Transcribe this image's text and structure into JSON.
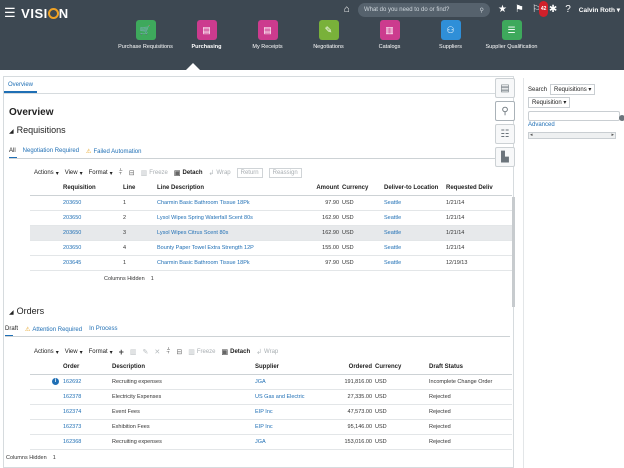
{
  "header": {
    "brand": "VISI",
    "brand_suffix": "N",
    "search_placeholder": "What do you need to do or find?",
    "notification_count": "42",
    "user_name": "Calvin Roth",
    "tiles": [
      {
        "label": "Purchase Requisitions",
        "color": "#3ea95c",
        "icon": "cart-icon"
      },
      {
        "label": "Purchasing",
        "color": "#cc3b8e",
        "icon": "document-icon"
      },
      {
        "label": "My Receipts",
        "color": "#cc3b8e",
        "icon": "receipt-icon"
      },
      {
        "label": "Negotiations",
        "color": "#79b13a",
        "icon": "negotiation-icon"
      },
      {
        "label": "Catalogs",
        "color": "#cc3b8e",
        "icon": "catalog-icon"
      },
      {
        "label": "Suppliers",
        "color": "#2f8fd8",
        "icon": "suppliers-icon"
      },
      {
        "label": "Supplier Qualification",
        "color": "#3ea95c",
        "icon": "checklist-icon"
      }
    ]
  },
  "page": {
    "tab": "Overview",
    "title": "Overview"
  },
  "requisitions": {
    "title": "Requisitions",
    "subtabs": [
      "All",
      "Negotiation Required",
      "Failed Automation"
    ],
    "toolbar": {
      "actions": "Actions",
      "view": "View",
      "format": "Format",
      "freeze": "Freeze",
      "detach": "Detach",
      "wrap": "Wrap",
      "return": "Return",
      "reassign": "Reassign"
    },
    "columns": [
      "Requisition",
      "Line",
      "Line Description",
      "Amount",
      "Currency",
      "Deliver-to Location",
      "Requested Deliv"
    ],
    "rows": [
      {
        "requisition": "203650",
        "line": "1",
        "description": "Charmin Basic Bathroom Tissue 18Pk",
        "amount": "97.90",
        "currency": "USD",
        "location": "Seattle",
        "date": "1/21/14"
      },
      {
        "requisition": "203650",
        "line": "2",
        "description": "Lysol Wipes Spring Waterfall Scent 80s",
        "amount": "162.90",
        "currency": "USD",
        "location": "Seattle",
        "date": "1/21/14"
      },
      {
        "requisition": "203650",
        "line": "3",
        "description": "Lysol Wipes Citrus Scent 80s",
        "amount": "162.90",
        "currency": "USD",
        "location": "Seattle",
        "date": "1/21/14"
      },
      {
        "requisition": "203650",
        "line": "4",
        "description": "Bounty Paper Towel Extra Strength 12P",
        "amount": "155.00",
        "currency": "USD",
        "location": "Seattle",
        "date": "1/21/14"
      },
      {
        "requisition": "203645",
        "line": "1",
        "description": "Charmin Basic Bathroom Tissue 18Pk",
        "amount": "97.90",
        "currency": "USD",
        "location": "Seattle",
        "date": "12/19/13"
      }
    ],
    "selected_row": 2,
    "columns_hidden_label": "Columns Hidden",
    "columns_hidden_count": "1"
  },
  "orders": {
    "title": "Orders",
    "subtabs": [
      "Draft",
      "Attention Required",
      "In Process"
    ],
    "toolbar": {
      "actions": "Actions",
      "view": "View",
      "format": "Format",
      "freeze": "Freeze",
      "detach": "Detach",
      "wrap": "Wrap"
    },
    "columns": [
      "Order",
      "Description",
      "Supplier",
      "Ordered",
      "Currency",
      "Draft Status"
    ],
    "rows": [
      {
        "order": "162692",
        "description": "Recruiting expenses",
        "supplier": "JGA",
        "ordered": "191,816.00",
        "currency": "USD",
        "status": "Incomplete Change Order"
      },
      {
        "order": "162378",
        "description": "Electricity Expenses",
        "supplier": "US Gas and Electric",
        "ordered": "27,335.00",
        "currency": "USD",
        "status": "Rejected"
      },
      {
        "order": "162374",
        "description": "Event Fees",
        "supplier": "EIP Inc",
        "ordered": "47,573.00",
        "currency": "USD",
        "status": "Rejected"
      },
      {
        "order": "162373",
        "description": "Exhibition Fees",
        "supplier": "EIP Inc",
        "ordered": "95,146.00",
        "currency": "USD",
        "status": "Rejected"
      },
      {
        "order": "162368",
        "description": "Recruiting expenses",
        "supplier": "JGA",
        "ordered": "153,016.00",
        "currency": "USD",
        "status": "Rejected"
      }
    ],
    "info_icon": "i",
    "columns_hidden_label": "Columns Hidden",
    "columns_hidden_count": "1"
  },
  "search_panel": {
    "label": "Search",
    "scope": "Requisitions",
    "field": "Requisition",
    "advanced": "Advanced"
  }
}
